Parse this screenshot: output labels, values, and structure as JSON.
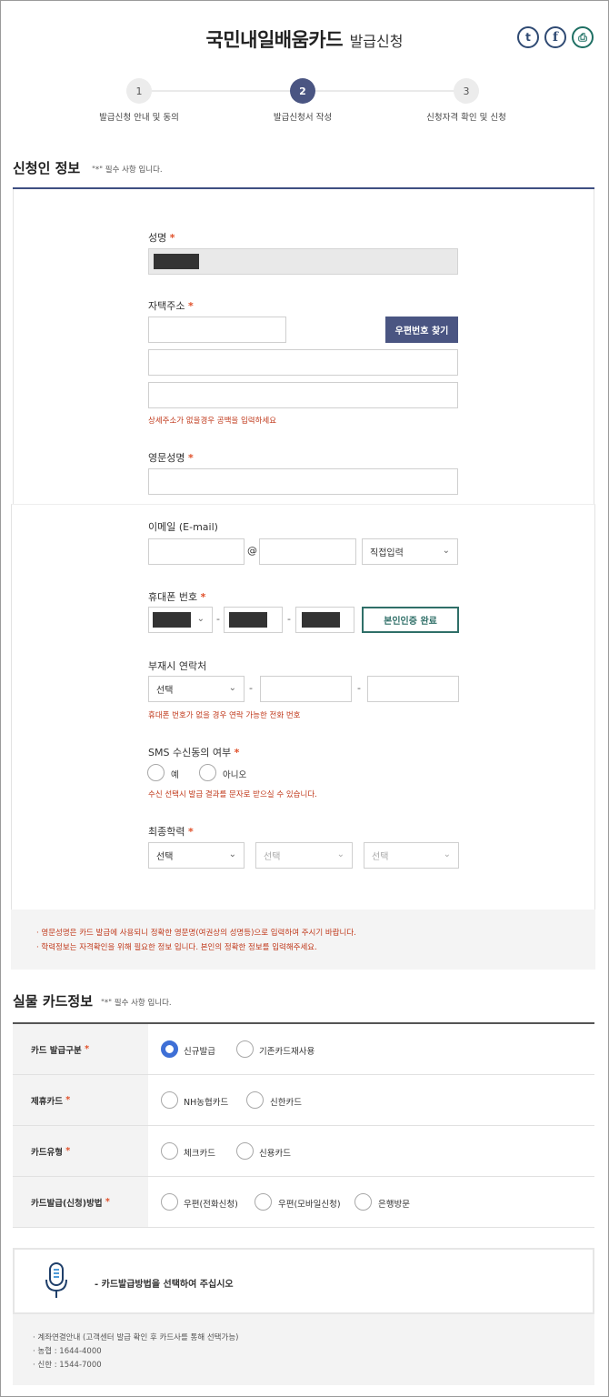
{
  "header": {
    "title_main": "국민내일배움카드",
    "title_sub": "발급신청",
    "share_twitter_glyph": "t",
    "share_facebook_glyph": "f",
    "share_print_glyph": "⎙"
  },
  "steps": [
    {
      "number": "1",
      "label": "발급신청 안내 및 동의",
      "active": false
    },
    {
      "number": "2",
      "label": "발급신청서 작성",
      "active": true
    },
    {
      "number": "3",
      "label": "신청자격 확인 및 신청",
      "active": false
    }
  ],
  "applicant": {
    "title": "신청인 정보",
    "required_note": "\"*\" 필수 사항 입니다.",
    "name_label": "성명",
    "address_label": "자택주소",
    "postcode_button": "우편번호 찾기",
    "address_hint": "상세주소가 없을경우 공백을 입력하세요",
    "english_name_label": "영문성명",
    "email_label": "이메일 (E-mail)",
    "email_at": "@",
    "email_domain_select": "직접입력",
    "mobile_label": "휴대폰 번호",
    "verify_button": "본인인증 완료",
    "alt_phone_label": "부재시 연락처",
    "alt_phone_select": "선택",
    "alt_phone_hint": "휴대폰 번호가 없을 경우 연락 가능한 전화 번호",
    "sms_label": "SMS 수신동의 여부",
    "sms_yes": "예",
    "sms_no": "아니오",
    "sms_hint": "수신 선택시 발급 결과를 문자로 받으실 수 있습니다.",
    "education_label": "최종학력",
    "education_select_1": "선택",
    "education_select_2": "선택",
    "education_select_3": "선택",
    "dash": "-",
    "star": "*"
  },
  "notice": {
    "line1": "· 영문성명은 카드 발급에 사용되니 정확한 영문명(여권상의 성명등)으로 입력하여 주시기 바랍니다.",
    "line2": "· 학력정보는 자격확인을 위해 필요한 정보 입니다. 본인의 정확한 정보를 입력해주세요."
  },
  "card_info": {
    "title": "실물 카드정보",
    "required_note": "\"*\" 필수 사항 입니다.",
    "rows": [
      {
        "label": "카드 발급구분",
        "options": [
          "신규발급",
          "기존카드재사용"
        ],
        "selected": 0
      },
      {
        "label": "제휴카드",
        "options": [
          "NH농협카드",
          "신한카드"
        ],
        "selected": -1
      },
      {
        "label": "카드유형",
        "options": [
          "체크카드",
          "신용카드"
        ],
        "selected": -1
      },
      {
        "label": "카드발급(신청)방법",
        "options": [
          "우편(전화신청)",
          "우편(모바일신청)",
          "은행방문"
        ],
        "selected": -1
      }
    ]
  },
  "guide": {
    "message": "- 카드발급방법을 선택하여 주십시오",
    "info_line1": "· 계좌연결안내 (고객센터 발급 확인 후 카드사를 통해 선택가능)",
    "info_line2": "· 농협 : 1644-4000",
    "info_line3": "· 신한 : 1544-7000"
  },
  "colors": {
    "accent": "#4a5582",
    "required_star": "#e0502a",
    "hint_red": "#c0391b",
    "verify_green": "#2f6f68",
    "radio_selected": "#3e6fd6"
  },
  "icons": {
    "select_chevron": "chevron-down-icon",
    "guide": "microphone-icon"
  }
}
